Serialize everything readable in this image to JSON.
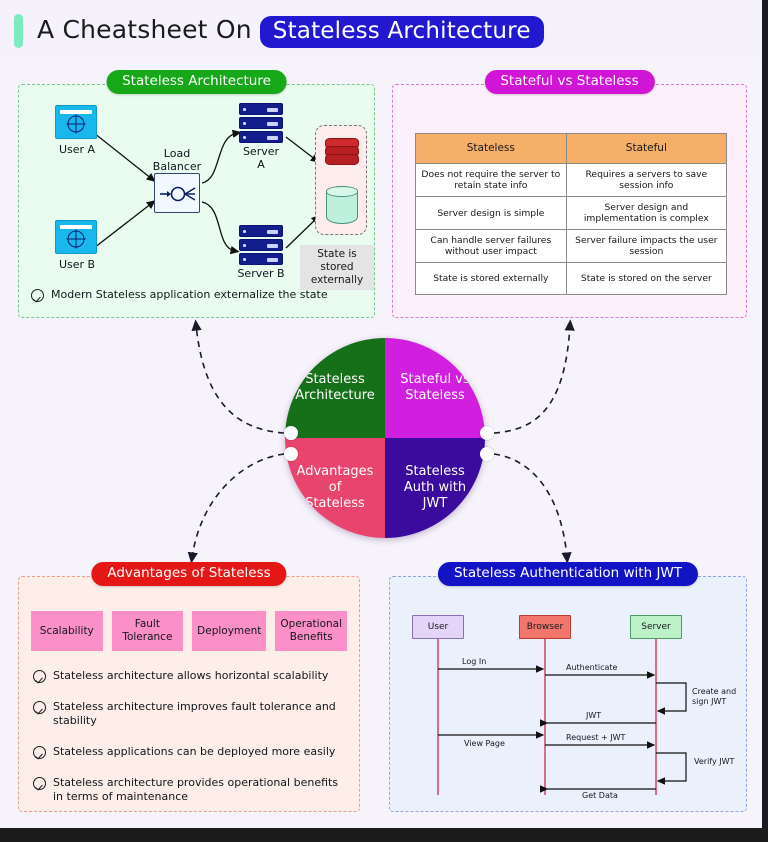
{
  "header": {
    "title_prefix": "A Cheatsheet On",
    "title_badge": "Stateless Architecture",
    "accent_color": "#7eeac0",
    "badge_color": "#2118cf"
  },
  "panels": {
    "architecture": {
      "badge": "Stateless Architecture",
      "badge_color": "#17a81a",
      "border_color": "#77c98f",
      "background": "#e9fcef",
      "nodes": {
        "user_a": "User A",
        "user_b": "User B",
        "load_balancer": "Load\nBalancer",
        "server_a": "Server\nA",
        "server_b": "Server B",
        "state_note": "State is stored\nexternally"
      },
      "footnote": "Modern Stateless application externalize the state"
    },
    "comparison": {
      "badge": "Stateful vs Stateless",
      "badge_color": "#d115d6",
      "border_color": "#d87ad0",
      "background": "#fdf0fb",
      "header_color": "#f6af68",
      "columns": [
        "Stateless",
        "Stateful"
      ],
      "rows": [
        [
          "Does not require the server to retain state info",
          "Requires a servers to save session info"
        ],
        [
          "Server design is simple",
          "Server design and implementation is complex"
        ],
        [
          "Can handle server failures without user impact",
          "Server failure impacts the user session"
        ],
        [
          "State is stored externally",
          "State is stored on the server"
        ]
      ]
    },
    "advantages": {
      "badge": "Advantages of Stateless",
      "badge_color": "#e51616",
      "border_color": "#e8a08d",
      "background": "#fdeee9",
      "tag_color": "#fb8fc8",
      "tags": [
        "Scalability",
        "Fault\nTolerance",
        "Deployment",
        "Operational\nBenefits"
      ],
      "bullets": [
        "Stateless architecture allows horizontal scalability",
        "Stateless architecture improves fault tolerance and stability",
        "Stateless applications can be deployed more easily",
        "Stateless architecture provides operational benefits in terms of maintenance"
      ]
    },
    "jwt": {
      "badge": "Stateless Authentication with JWT",
      "badge_color": "#1313c6",
      "border_color": "#8ea5d8",
      "background": "#eaf1fd",
      "actors": [
        {
          "label": "User",
          "color": "#e4d4f7"
        },
        {
          "label": "Browser",
          "color": "#f2766b"
        },
        {
          "label": "Server",
          "color": "#bdf2c9"
        }
      ],
      "messages": [
        "Log In",
        "Authenticate",
        "Create and sign JWT",
        "JWT",
        "View Page",
        "Request + JWT",
        "Verify JWT",
        "Get Data"
      ]
    }
  },
  "hub": {
    "quadrants": [
      {
        "id": "top-left",
        "label": "Stateless\nArchitecture",
        "color": "#16701a"
      },
      {
        "id": "top-right",
        "label": "Stateful vs\nStateless",
        "color": "#d11fe0"
      },
      {
        "id": "bottom-left",
        "label": "Advantages\nof\nStateless",
        "color": "#e8456e"
      },
      {
        "id": "bottom-right",
        "label": "Stateless\nAuth with\nJWT",
        "color": "#3b0b9e"
      }
    ]
  }
}
